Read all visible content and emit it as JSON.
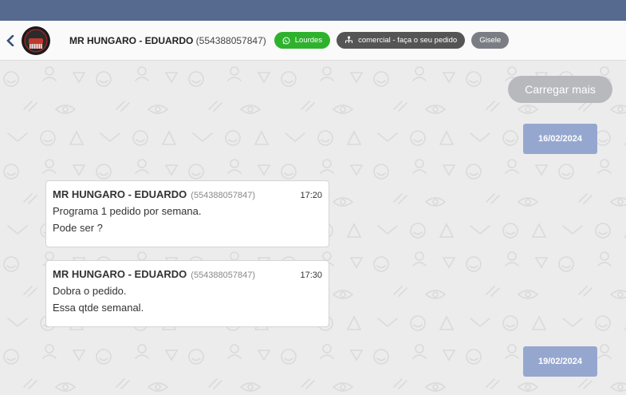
{
  "header": {
    "back_icon": "chevron-left-icon",
    "contact_name": "MR HUNGARO - EDUARDO",
    "contact_phone": "(554388057847)",
    "tags": [
      {
        "label": "Lourdes",
        "icon": "whatsapp-icon",
        "color": "#2eb22e"
      },
      {
        "label": "comercial - faça o seu pedido",
        "icon": "sitemap-icon",
        "color": "#555555"
      },
      {
        "label": "Gisele",
        "color": "#7a7e84"
      }
    ]
  },
  "chat": {
    "load_more_label": "Carregar mais",
    "dates": [
      "16/02/2024",
      "19/02/2024"
    ],
    "messages": [
      {
        "sender": "MR HUNGARO - EDUARDO",
        "phone": "(554388057847)",
        "time": "17:20",
        "lines": [
          "Programa 1 pedido por semana.",
          "Pode ser ?"
        ]
      },
      {
        "sender": "MR HUNGARO - EDUARDO",
        "phone": "(554388057847)",
        "time": "17:30",
        "lines": [
          "Dobra o pedido.",
          "Essa qtde semanal."
        ]
      }
    ]
  },
  "colors": {
    "topbar": "#56698f",
    "date_chip": "#96a7cf",
    "background": "#ececec"
  }
}
